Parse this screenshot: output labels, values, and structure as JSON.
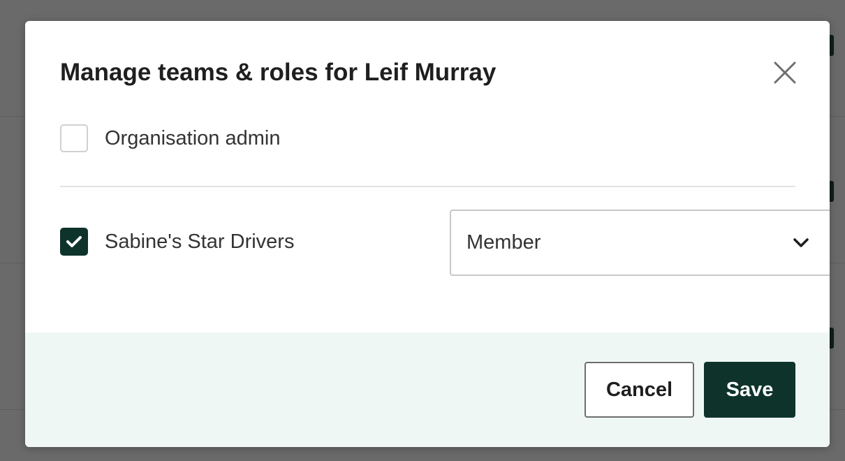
{
  "modal": {
    "title": "Manage teams & roles for Leif Murray",
    "close_icon": "close-icon"
  },
  "org_admin": {
    "label": "Organisation admin",
    "checked": false
  },
  "team": {
    "label": "Sabine's Star Drivers",
    "checked": true,
    "check_icon": "checkmark-icon",
    "role": {
      "value": "Member",
      "icon": "chevron-down-icon"
    }
  },
  "footer": {
    "cancel_label": "Cancel",
    "save_label": "Save"
  },
  "colors": {
    "backdrop": "#6a6a6a",
    "accent": "#0e332b",
    "footer_bg": "#eff7f5"
  }
}
